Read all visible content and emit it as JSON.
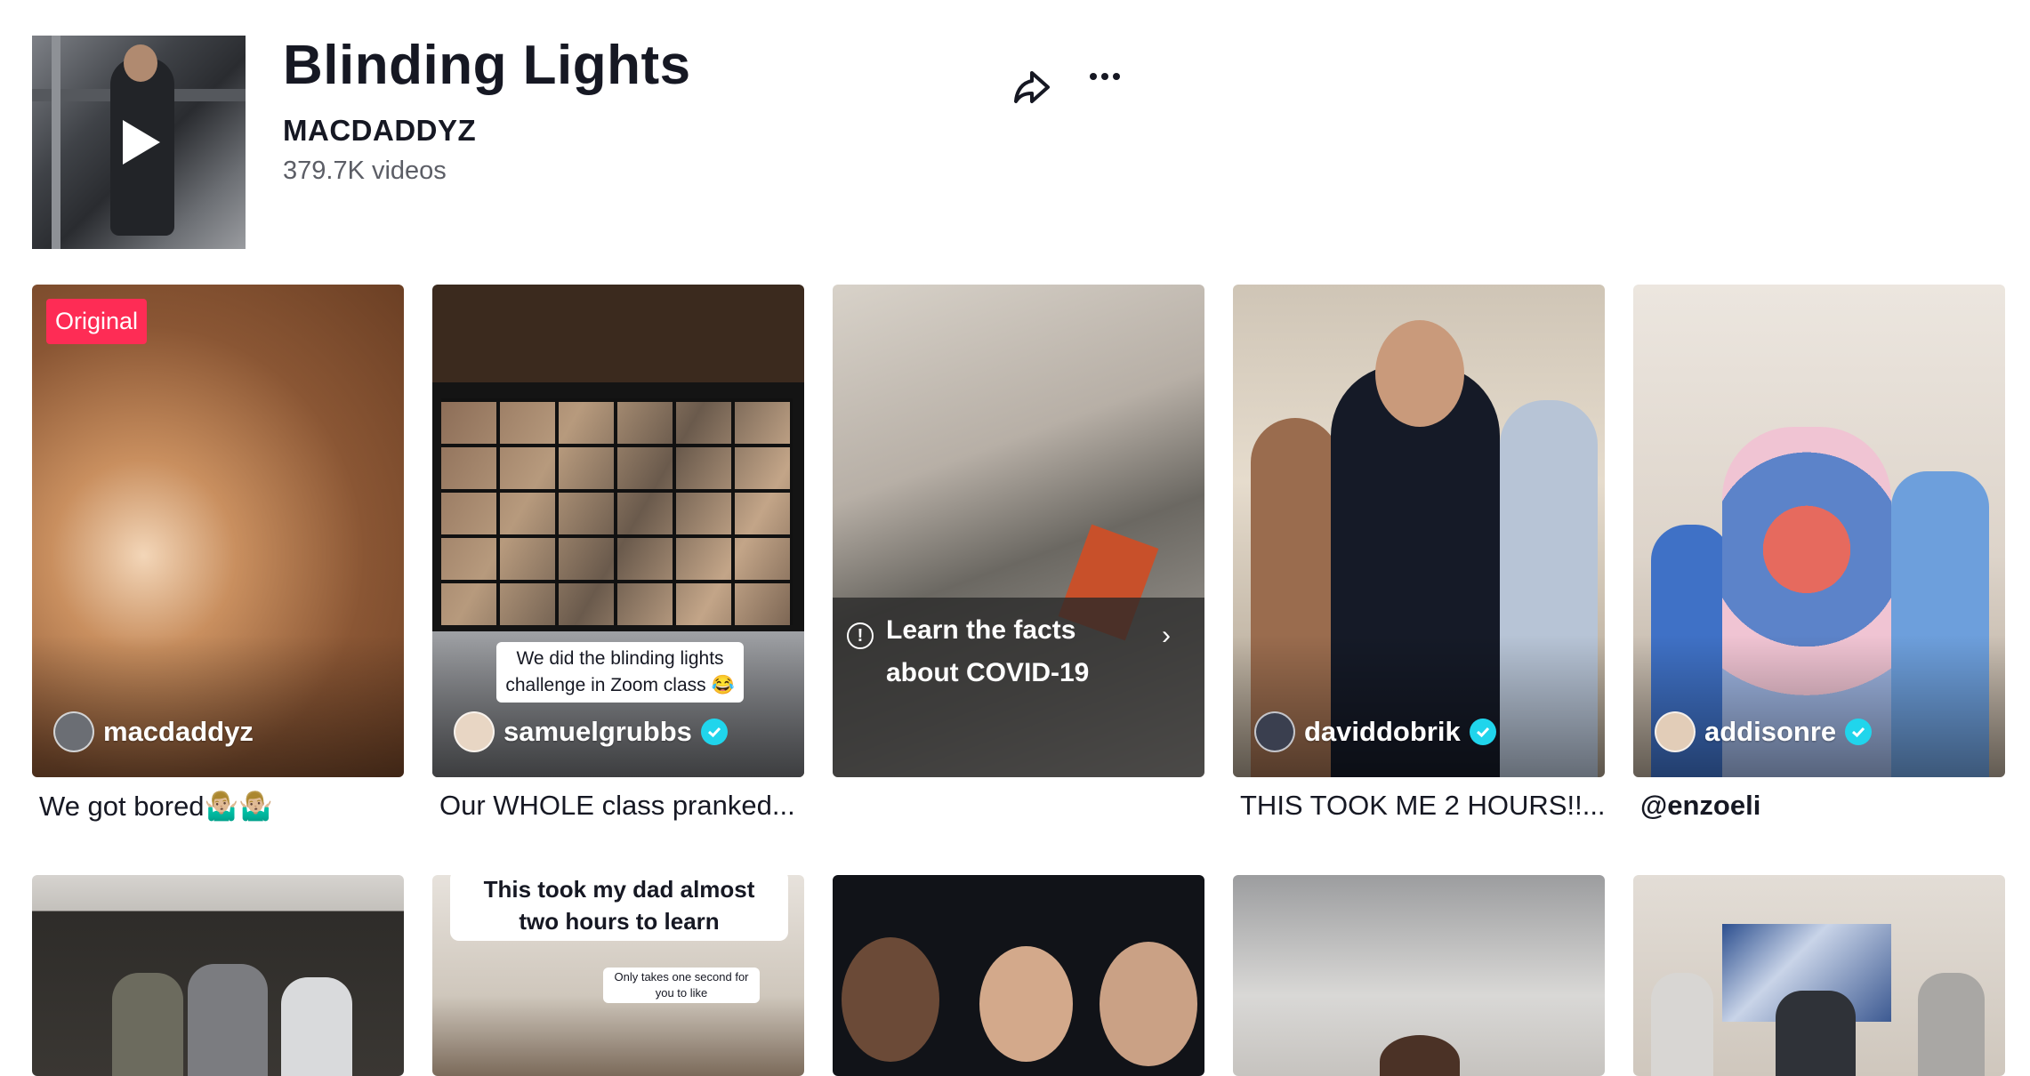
{
  "sound": {
    "title": "Blinding Lights",
    "author": "MACDADDYZ",
    "video_count": "379.7K videos"
  },
  "header_actions": {
    "share_icon": "share-arrow-icon",
    "more_icon": "more-horizontal-icon"
  },
  "colors": {
    "badge": "#fe2c55",
    "verified": "#20d5ec",
    "text": "#161823",
    "muted": "#5c5e66"
  },
  "videos": [
    {
      "badge": "Original",
      "handle": "macdaddyz",
      "verified": false,
      "caption": "We got bored🤷🏼‍♂️🤷🏼‍♂️"
    },
    {
      "overlay_line1": "We did the blinding lights",
      "overlay_line2": "challenge in Zoom class 😂",
      "handle": "samuelgrubbs",
      "verified": true,
      "caption": "Our WHOLE class pranked..."
    },
    {
      "notice_line1": "Learn the facts",
      "notice_line2": "about COVID-19"
    },
    {
      "handle": "daviddobrik",
      "verified": true,
      "caption": "THIS TOOK ME 2 HOURS!!..."
    },
    {
      "handle": "addisonre",
      "verified": true,
      "caption": "@enzoeli"
    },
    {},
    {
      "overlay_line1": "This took my dad almost",
      "overlay_line2": "two hours to learn",
      "overlay_small1": "Only takes one second for",
      "overlay_small2": "you to like"
    },
    {},
    {},
    {}
  ]
}
